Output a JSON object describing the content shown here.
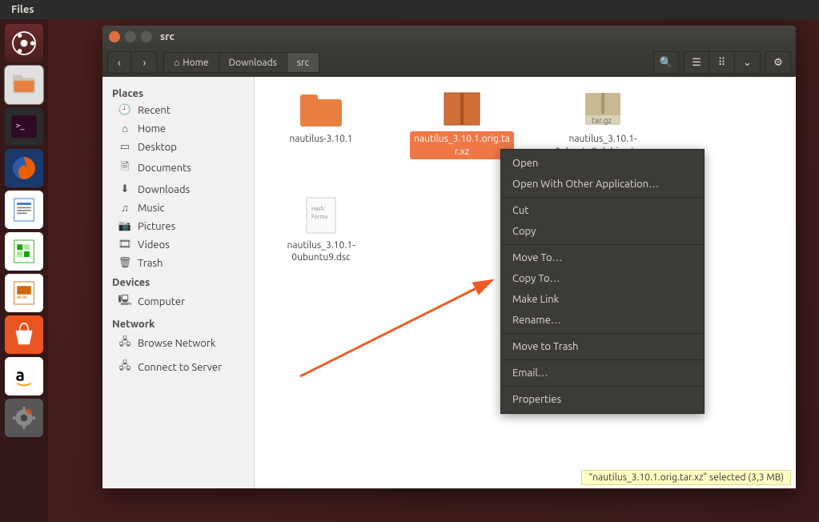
{
  "menubar": {
    "app": "Files"
  },
  "window": {
    "title": "src",
    "path": [
      "Home",
      "Downloads",
      "src"
    ]
  },
  "sidebar": {
    "groups": [
      {
        "heading": "Places",
        "items": [
          {
            "icon": "🕘",
            "label": "Recent"
          },
          {
            "icon": "⌂",
            "label": "Home"
          },
          {
            "icon": "▭",
            "label": "Desktop"
          },
          {
            "icon": "🗎",
            "label": "Documents"
          },
          {
            "icon": "⬇",
            "label": "Downloads"
          },
          {
            "icon": "♫",
            "label": "Music"
          },
          {
            "icon": "📷",
            "label": "Pictures"
          },
          {
            "icon": "🎞",
            "label": "Videos"
          },
          {
            "icon": "🗑",
            "label": "Trash"
          }
        ]
      },
      {
        "heading": "Devices",
        "items": [
          {
            "icon": "🖳",
            "label": "Computer"
          }
        ]
      },
      {
        "heading": "Network",
        "items": [
          {
            "icon": "🖧",
            "label": "Browse Network"
          },
          {
            "icon": "🖧",
            "label": "Connect to Server"
          }
        ]
      }
    ]
  },
  "files": [
    {
      "type": "folder",
      "label": "nautilus-3.10.1",
      "selected": false
    },
    {
      "type": "archive",
      "label": "nautilus_3.10.1.orig.tar.xz",
      "selected": true
    },
    {
      "type": "targz",
      "label": "nautilus_3.10.1-0ubuntu9.debian.tar.gz",
      "selected": false
    },
    {
      "type": "doc",
      "label": "nautilus_3.10.1-0ubuntu9.dsc",
      "selected": false
    }
  ],
  "context_menu": [
    "Open",
    "Open With Other Application…",
    "-",
    "Cut",
    "Copy",
    "-",
    "Move To…",
    "Copy To…",
    "Make Link",
    "Rename…",
    "-",
    "Move to Trash",
    "-",
    "Email…",
    "-",
    "Properties"
  ],
  "status": "“nautilus_3.10.1.orig.tar.xz” selected  (3,3 MB)"
}
